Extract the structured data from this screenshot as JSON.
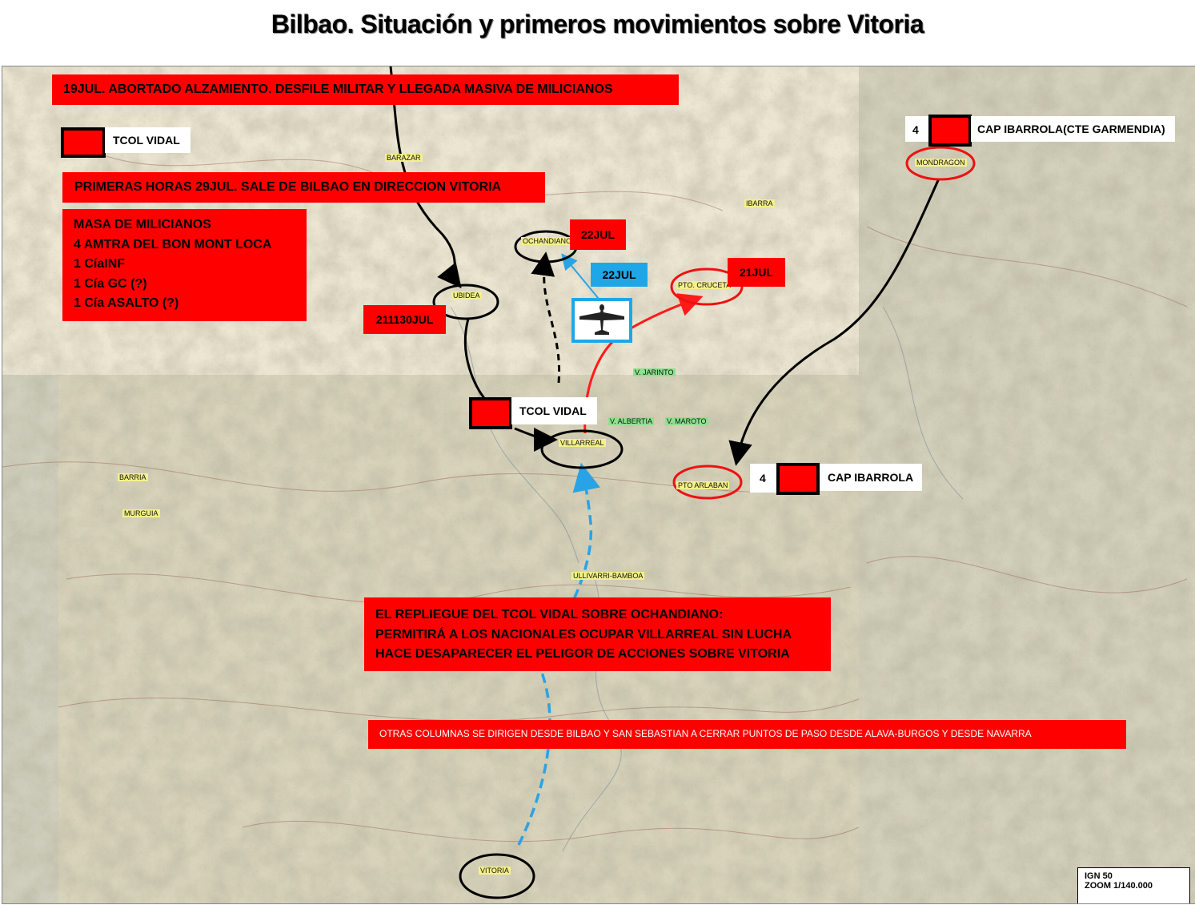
{
  "title": "Bilbao. Situación y primeros movimientos sobre Vitoria",
  "colors": {
    "red_label": "#ff0000",
    "black_route": "#000000",
    "red_route": "#ff1a1a",
    "blue_route": "#29a3e6",
    "map_paper": "#d6d2b8"
  },
  "banners": {
    "jul19": "19JUL. ABORTADO ALZAMIENTO. DESFILE MILITAR Y LLEGADA MASIVA DE MILICIANOS",
    "jul29": "PRIMERAS HORAS  29JUL. SALE DE BILBAO EN DIRECCION VITORIA",
    "forces": [
      "MASA DE MILICIANOS",
      "4 AMTRA DEL BON MONT LOCA",
      "1 CíaINF",
      "1 Cía GC (?)",
      "1 Cía ASALTO (?)"
    ],
    "repliegue": [
      "EL REPLIEGUE DEL TCOL VIDAL SOBRE OCHANDIANO:",
      "PERMITIRÁ A LOS NACIONALES OCUPAR VILLARREAL SIN LUCHA",
      "HACE DESAPARECER EL PELIGOR DE ACCIONES SOBRE VITORIA"
    ],
    "otras": "OTRAS COLUMNAS SE DIRIGEN DESDE BILBAO Y SAN SEBASTIAN A CERRAR PUNTOS DE PASO DESDE ALAVA-BURGOS Y DESDE NAVARRA"
  },
  "units": {
    "vidal_legend": "TCOL VIDAL",
    "vidal_map": "TCOL VIDAL",
    "ibarrola_top_num": "4",
    "ibarrola_top": "CAP IBARROLA(CTE GARMENDIA)",
    "ibarrola_bottom_num": "4",
    "ibarrola_bottom": "CAP IBARROLA"
  },
  "dates": {
    "ochandiano": "22JUL",
    "aircraft": "22JUL",
    "crucetal": "21JUL",
    "ubidea": "211130JUL"
  },
  "places": {
    "barazar": "BARAZAR",
    "ibarra": "IBARRA",
    "mondragon": "MONDRAGON",
    "ochandiano": "OCHANDIANO",
    "ubidea": "UBIDEA",
    "crucetal": "PTO. CRUCETA",
    "jarinto": "V. JARINTO",
    "albertia": "V. ALBERTIA",
    "maroto": "V. MAROTO",
    "villarreal": "VILLARREAL",
    "arlaban": "PTO ARLABAN",
    "barria": "BARRIA",
    "murguia": "MURGUIA",
    "ullivarri": "ULLIVARRI-BAMBOA",
    "vitoria": "VITORIA"
  },
  "aircraft_icon": "aircraft-icon",
  "scale": {
    "line1": "IGN 50",
    "line2": "ZOOM  1/140.000"
  }
}
